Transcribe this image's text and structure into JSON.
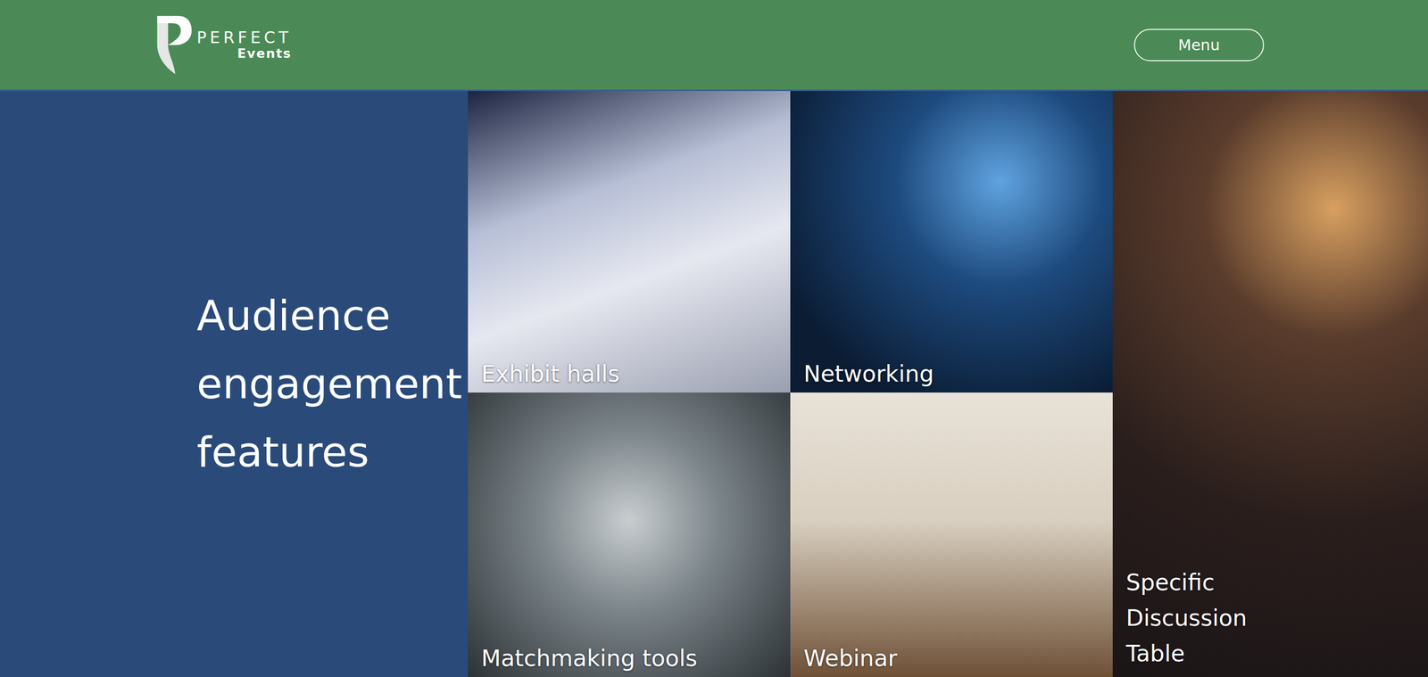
{
  "header": {
    "logo": {
      "brand": "PERFECT",
      "sub": "Events"
    },
    "menu": "Menu"
  },
  "heading": "Audience engagement features",
  "tiles": [
    {
      "label": "Exhibit halls"
    },
    {
      "label": "Networking"
    },
    {
      "label": "Specific Discussion Table"
    },
    {
      "label": "Matchmaking tools"
    },
    {
      "label": "Webinar"
    }
  ]
}
